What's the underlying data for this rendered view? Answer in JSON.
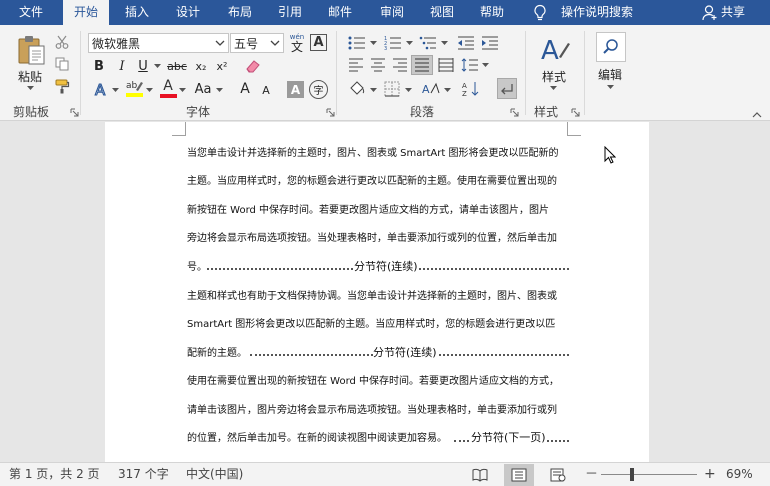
{
  "tabs": [
    "文件",
    "开始",
    "插入",
    "设计",
    "布局",
    "引用",
    "邮件",
    "审阅",
    "视图",
    "帮助"
  ],
  "active_tab": "开始",
  "tell_me": "操作说明搜索",
  "share": "共享",
  "ribbon": {
    "clipboard": {
      "paste_label": "粘贴",
      "group_label": "剪贴板"
    },
    "font": {
      "font_name": "微软雅黑",
      "font_size": "五号",
      "wen_label": "wén",
      "wen_char": "文",
      "a_box": "A",
      "bold": "B",
      "italic": "I",
      "underline": "U",
      "strike": "abc",
      "subscript": "x₂",
      "superscript": "x²",
      "font_color_letter": "A",
      "highlight_letter": "ab",
      "change_case": "Aa",
      "grow": "A",
      "shrink": "A",
      "char_shading": "A",
      "enclose": "字",
      "group_label": "字体"
    },
    "paragraph": {
      "group_label": "段落"
    },
    "styles": {
      "label": "样式",
      "group_label": "样式"
    },
    "editing": {
      "label": "编辑"
    }
  },
  "document": {
    "lines": [
      "当您单击设计并选择新的主题时，图片、图表或 SmartArt 图形将会更改以匹配新的",
      "主题。当应用样式时，您的标题会进行更改以匹配新的主题。使用在需要位置出现的",
      "新按钮在 Word 中保存时间。若要更改图片适应文档的方式，请单击该图片，图片",
      "旁边将会显示布局选项按钮。当处理表格时，单击要添加行或列的位置，然后单击加",
      "号。",
      "主题和样式也有助于文档保持协调。当您单击设计并选择新的主题时，图片、图表或",
      "SmartArt 图形将会更改以匹配新的主题。当应用样式时，您的标题会进行更改以匹",
      "配新的主题。",
      "使用在需要位置出现的新按钮在 Word 中保存时间。若要更改图片适应文档的方式，",
      "请单击该图片，图片旁边将会显示布局选项按钮。当处理表格时，单击要添加行或列",
      "的位置，然后单击加号。在新的阅读视图中阅读更加容易。"
    ],
    "breaks": [
      "分节符(连续)",
      "分节符(连续)",
      "分节符(下一页)"
    ]
  },
  "status": {
    "page": "第 1 页，共 2 页",
    "words": "317 个字",
    "lang": "中文(中国)",
    "zoom_minus": "－",
    "zoom_plus": "+",
    "zoom_percent": 69,
    "zoom_label": "69%"
  },
  "colors": {
    "titlebar": "#2b579a",
    "font_color_bar": "#e81123",
    "highlight_bar": "#ffff00",
    "accent_blue": "#2b5797"
  }
}
